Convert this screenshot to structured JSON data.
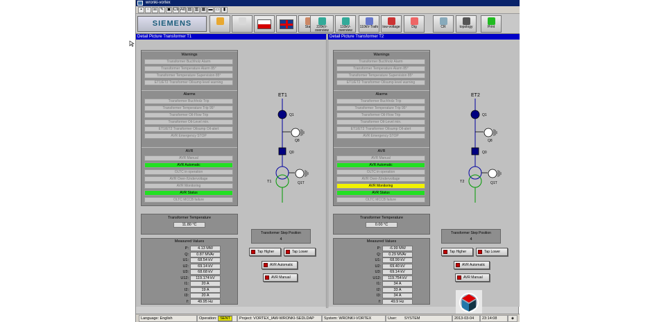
{
  "window_title": "wronki-vortex",
  "quick_toolbar": [
    "▪",
    "▫",
    "☒",
    "✎",
    "▣",
    "Ctrl",
    "Alt",
    "▤",
    "▥",
    "▦",
    "▬",
    "▭",
    "▮"
  ],
  "toolbar": {
    "logo": "SIEMENS",
    "buttons": [
      {
        "label": "",
        "icon": "key-icon"
      },
      {
        "label": "",
        "icon": "key2-icon"
      },
      {
        "label": "",
        "icon": "flag-pl-icon"
      },
      {
        "label": "",
        "icon": "flag-uk-icon"
      },
      {
        "label": "Start",
        "icon": "home-icon"
      },
      {
        "label": "220kV-overview",
        "icon": "globe-icon"
      },
      {
        "label": "110kV-overview",
        "icon": "globe-icon"
      },
      {
        "label": "110kV-Trafo",
        "icon": "transformer-icon"
      },
      {
        "label": "low-voltage",
        "icon": "lowvoltage-icon"
      },
      {
        "label": "Dig",
        "icon": "document-icon"
      },
      {
        "label": "CR",
        "icon": "cr-icon"
      },
      {
        "label": "topology",
        "icon": "topology-icon"
      },
      {
        "label": "Print",
        "icon": "print-icon"
      }
    ]
  },
  "panels": [
    {
      "title": "Detail Picture Transformer T1",
      "warnings_title": "Warnings",
      "warnings": [
        "Transformer Buchholz Alarm",
        "Transformer Temperature Alarm 85°",
        "Transformer Temperature Supervision 85°",
        "ET1/ET2 Transformer Oilsump level warning"
      ],
      "alarms_title": "Alarms",
      "alarms": [
        "Transformer Buchholz Trip",
        "Transformer Temperature Trip 95°",
        "Transformer Oil-Flow Trip",
        "Transformer Oil-Level min.",
        "ET1/ET2 Transformer Oilsump Oil-alert",
        "AVR Emergency STOP"
      ],
      "avr_title": "AVR",
      "avr": [
        {
          "label": "AVR Manual",
          "state": "off"
        },
        {
          "label": "AVR Automatic",
          "state": "green"
        },
        {
          "label": "OLTC in operation",
          "state": "off"
        },
        {
          "label": "AVR Over-/Undervoltage",
          "state": "off"
        },
        {
          "label": "AVR Monitoring",
          "state": "off"
        },
        {
          "label": "AVR Status",
          "state": "green"
        },
        {
          "label": "OLTC MCCB failure",
          "state": "off"
        }
      ],
      "temp_title": "Transformer Temperature",
      "temp_value": "11.80 °C",
      "measured_title": "Measured Values",
      "measured": [
        {
          "label": "P:",
          "value": "4.13 MW"
        },
        {
          "label": "Q:",
          "value": "0.87 MVAr"
        },
        {
          "label": "U1:",
          "value": "68.54 kV"
        },
        {
          "label": "U2:",
          "value": "69.14 kV"
        },
        {
          "label": "U3:",
          "value": "68.68 kV"
        },
        {
          "label": "U12:",
          "value": "119.174 kV"
        },
        {
          "label": "I1:",
          "value": "20 A"
        },
        {
          "label": "I2:",
          "value": "19 A"
        },
        {
          "label": "I3:",
          "value": "20 A"
        },
        {
          "label": "f:",
          "value": "49.95 Hz"
        }
      ],
      "feeder": "ET1",
      "labels": {
        "q1": "Q1",
        "q8": "Q8",
        "q0": "Q0",
        "t": "T1",
        "q1t": "Q1T"
      },
      "tap_title": "Transformer Step Position",
      "tap_value": "4",
      "tap_higher": "Tap Higher",
      "tap_lower": "Tap Lower",
      "avr_auto_btn": "AVR Automatic",
      "avr_manual_btn": "AVR Manual"
    },
    {
      "title": "Detail Picture Transformer T2",
      "warnings_title": "Warnings",
      "warnings": [
        "Transformer Buchholz Alarm",
        "Transformer Temperature Alarm 85°",
        "Transformer Temperature Supervision 85°",
        "ET1/ET2 Transformer Oilsump level warning"
      ],
      "alarms_title": "Alarms",
      "alarms": [
        "Transformer Buchholz Trip",
        "Transformer Temperature Trip 95°",
        "Transformer Oil-Flow Trip",
        "Transformer Oil-Level min.",
        "ET1/ET2 Transformer Oilsump Oil-alert",
        "AVR Emergency STOP"
      ],
      "avr_title": "AVR",
      "avr": [
        {
          "label": "AVR Manual",
          "state": "off"
        },
        {
          "label": "AVR Automatic",
          "state": "green"
        },
        {
          "label": "OLTC in operation",
          "state": "off"
        },
        {
          "label": "AVR Over-/Undervoltage",
          "state": "off"
        },
        {
          "label": "AVR Monitoring",
          "state": "yellow"
        },
        {
          "label": "AVR Status",
          "state": "green"
        },
        {
          "label": "OLTC MCCB failure",
          "state": "off"
        }
      ],
      "temp_title": "Transformer Temperature",
      "temp_value": "0.00 °C",
      "measured_title": "Measured Values",
      "measured": [
        {
          "label": "P:",
          "value": "-6.99 MW"
        },
        {
          "label": "Q:",
          "value": "0.29 MVAr"
        },
        {
          "label": "U1:",
          "value": "68.99 kV"
        },
        {
          "label": "U2:",
          "value": "69.40 kV"
        },
        {
          "label": "U3:",
          "value": "69.14 kV"
        },
        {
          "label": "U12:",
          "value": "119.754 kV"
        },
        {
          "label": "I1:",
          "value": "34 A"
        },
        {
          "label": "I2:",
          "value": "33 A"
        },
        {
          "label": "I3:",
          "value": "34 A"
        },
        {
          "label": "f:",
          "value": "49.9 Hz"
        }
      ],
      "feeder": "ET2",
      "labels": {
        "q1": "Q1",
        "q8": "Q8",
        "q0": "Q0",
        "t": "T2",
        "q1t": "Q1T"
      },
      "tap_title": "Transformer Step Position",
      "tap_value": "4",
      "tap_higher": "Tap Higher",
      "tap_lower": "Tap Lower",
      "avr_auto_btn": "AVR Automatic",
      "avr_manual_btn": "AVR Manual"
    }
  ],
  "status": {
    "language": "Language: English",
    "operation_label": "Operation:",
    "operation_value": "SENT",
    "project": "Project: VORTEX_IAW-WRONKI-SEDLDAP",
    "system": "System: WRONKI-VORTEX",
    "user_label": "User:",
    "user_value": "SYSTEM",
    "date": "2013-03-04",
    "time": "23:14:08"
  },
  "colors": {
    "header_blue": "#0000c8",
    "green": "#22e022",
    "yellow": "#f2f200",
    "node_blue": "#000080",
    "trafo_green": "#009a00"
  }
}
